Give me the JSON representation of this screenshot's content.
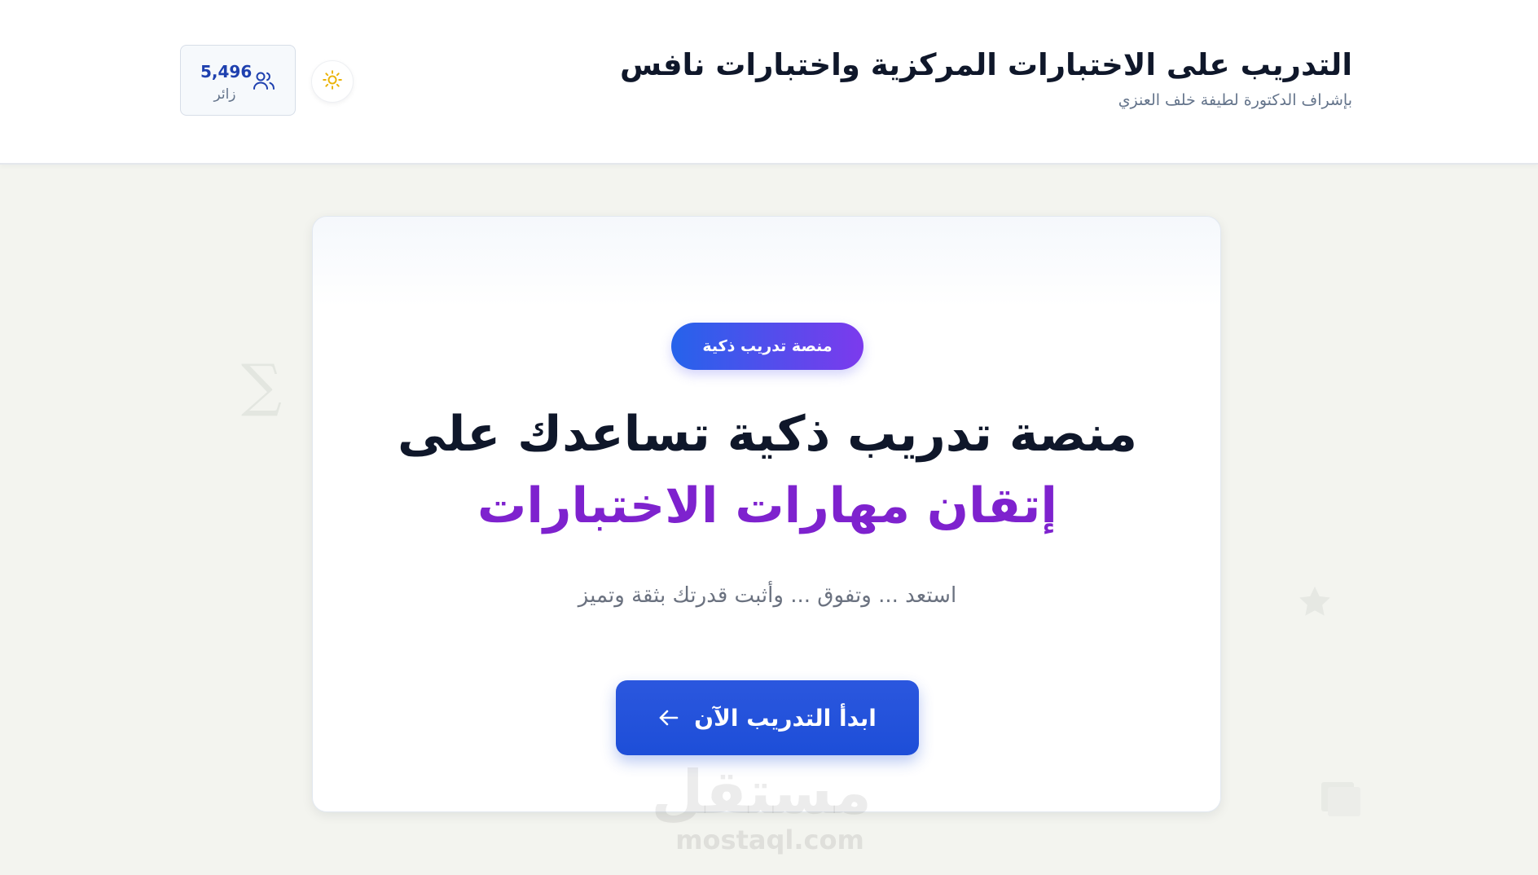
{
  "header": {
    "title": "التدريب على الاختبارات المركزية واختبارات نافس",
    "subtitle": "بإشراف الدكتورة لطيفة خلف العنزي",
    "theme_toggle_icon": "sun-icon",
    "visitors": {
      "count": "5,496",
      "label": "زائر",
      "icon": "users-icon"
    }
  },
  "hero": {
    "badge": "منصة تدريب ذكية",
    "headline_line1": "منصة تدريب ذكية تساعدك على",
    "headline_line2": "إتقان مهارات الاختبارات",
    "tagline": "استعد ... وتفوق ... وأثبت قدرتك بثقة وتميز",
    "cta_label": "ابدأ التدريب الآن",
    "cta_icon": "arrow-left-icon"
  },
  "decorations": {
    "sigma": "∑"
  },
  "watermark": {
    "arabic": "مستقل",
    "latin": "mostaql.com"
  },
  "colors": {
    "primary": "#1d4ed8",
    "accent_purple": "#7e22ce",
    "badge_start": "#2563eb",
    "badge_end": "#7c3aed",
    "sun": "#eab308",
    "page_bg": "#f3f4ef"
  }
}
